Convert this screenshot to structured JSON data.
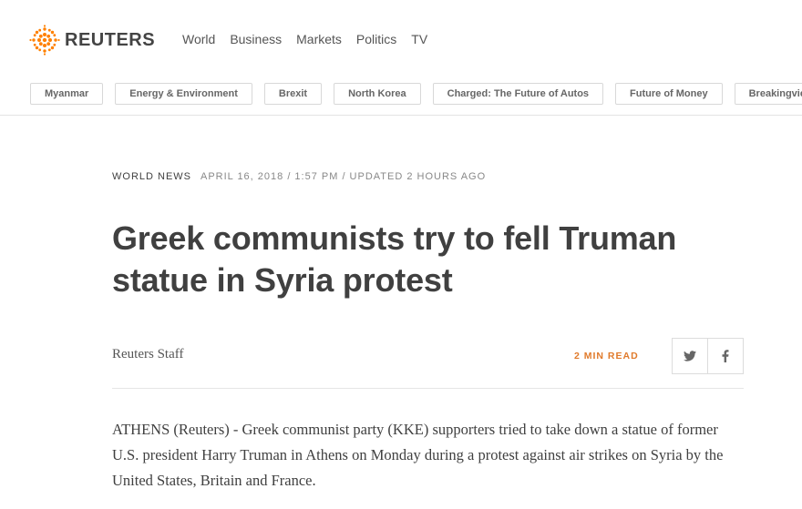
{
  "header": {
    "brand": "REUTERS",
    "brand_color": "#ff8000",
    "nav": [
      "World",
      "Business",
      "Markets",
      "Politics",
      "TV"
    ],
    "pills": [
      "Myanmar",
      "Energy & Environment",
      "Brexit",
      "North Korea",
      "Charged: The Future of Autos",
      "Future of Money",
      "Breakingviews"
    ]
  },
  "article": {
    "section": "World News",
    "dateline": "APRIL 16, 2018 / 1:57 PM / UPDATED 2 HOURS AGO",
    "headline": "Greek communists try to fell Truman statue in Syria protest",
    "author": "Reuters Staff",
    "read_time": "2 MIN READ",
    "share_icons": [
      "twitter-icon",
      "facebook-icon"
    ],
    "body": "ATHENS (Reuters) - Greek communist party (KKE) supporters tried to take down a statue of former U.S. president Harry Truman in Athens on Monday during a protest against air strikes on Syria by the United States, Britain and France."
  }
}
